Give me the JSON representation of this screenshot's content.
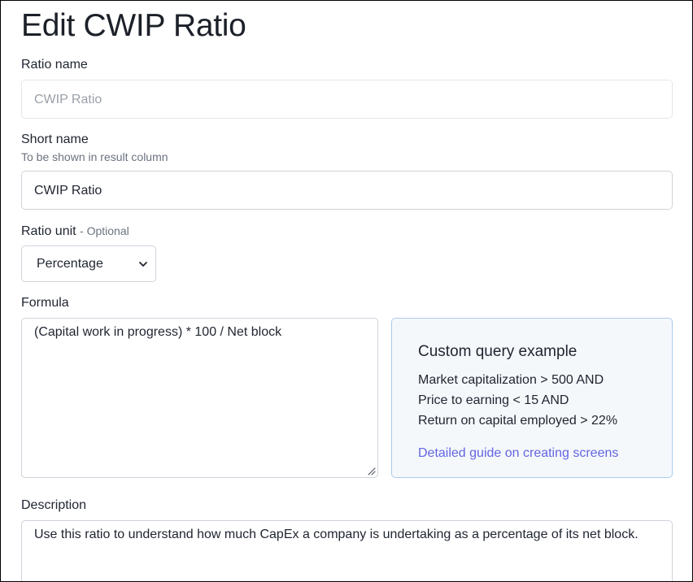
{
  "page": {
    "title": "Edit CWIP Ratio"
  },
  "form": {
    "ratio_name": {
      "label": "Ratio name",
      "value": "CWIP Ratio"
    },
    "short_name": {
      "label": "Short name",
      "hint": "To be shown in result column",
      "value": "CWIP Ratio"
    },
    "ratio_unit": {
      "label": "Ratio unit",
      "optional": "- Optional",
      "selected": "Percentage"
    },
    "formula": {
      "label": "Formula",
      "value": "(Capital work in progress) * 100 / Net block"
    },
    "description": {
      "label": "Description",
      "value": "Use this ratio to understand how much CapEx a company is undertaking as a percentage of its net block."
    }
  },
  "example": {
    "title": "Custom query example",
    "lines": [
      "Market capitalization > 500 AND",
      "Price to earning < 15 AND",
      "Return on capital employed > 22%"
    ],
    "link": "Detailed guide on creating screens"
  },
  "colors": {
    "link": "#6366e0",
    "example_border": "#a9cbee",
    "example_background": "#f5f8fb",
    "input_border": "#cfd3da",
    "muted_text": "#6b7280"
  },
  "icons": {
    "select_caret": "chevron-down-icon",
    "textarea_resize": "resize-grip-icon"
  }
}
